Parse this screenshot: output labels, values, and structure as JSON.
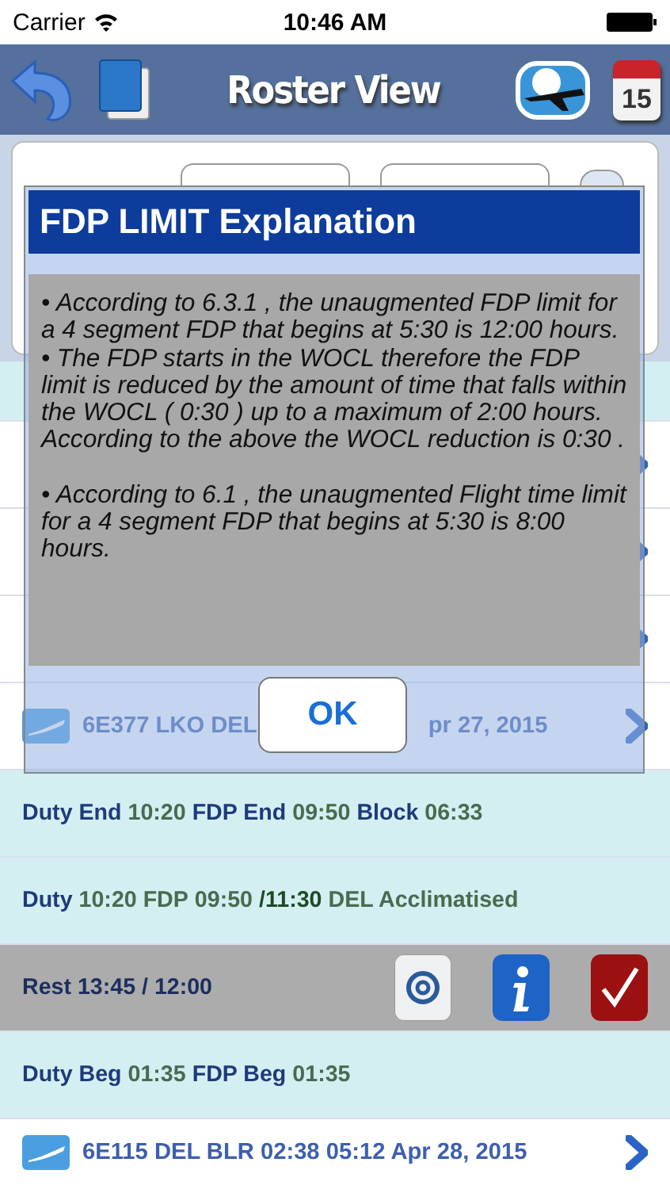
{
  "status_bar": {
    "carrier": "Carrier",
    "time": "10:46 AM"
  },
  "nav": {
    "title": "Roster View",
    "calendar_day": "15"
  },
  "rows": [
    {
      "kind": "band"
    },
    {
      "kind": "flight"
    },
    {
      "kind": "flight"
    },
    {
      "kind": "flight"
    },
    {
      "kind": "flight",
      "parts": [
        "6E377 LKO DEL",
        "pr 27, 2015"
      ]
    },
    {
      "kind": "duty",
      "segments": [
        {
          "kind": "label",
          "text": "Duty End"
        },
        {
          "kind": "value",
          "text": "10:20"
        },
        {
          "kind": "label",
          "text": "FDP End"
        },
        {
          "kind": "value",
          "text": "09:50"
        },
        {
          "kind": "label",
          "text": "Block"
        },
        {
          "kind": "value",
          "text": "06:33"
        }
      ]
    },
    {
      "kind": "duty",
      "segments": [
        {
          "kind": "label",
          "text": "Duty"
        },
        {
          "kind": "value",
          "text": "10:20 FDP"
        },
        {
          "kind": "value",
          "text": "09:50"
        },
        {
          "kind": "strong",
          "text": "/11:30"
        },
        {
          "kind": "value",
          "text": "DEL Acclimatised"
        }
      ]
    },
    {
      "kind": "rest",
      "text": "Rest 13:45 / 12:00"
    },
    {
      "kind": "duty",
      "segments": [
        {
          "kind": "label",
          "text": "Duty Beg"
        },
        {
          "kind": "value",
          "text": "01:35"
        },
        {
          "kind": "label",
          "text": "FDP Beg"
        },
        {
          "kind": "value",
          "text": "01:35"
        }
      ]
    },
    {
      "kind": "flight",
      "parts": [
        "6E115 DEL BLR 02:38 05:12 Apr 28, 2015"
      ]
    }
  ],
  "dialog": {
    "title": "FDP LIMIT Explanation",
    "paragraphs": [
      "•  According to 6.3.1 , the unaugmented FDP limit for a 4 segment FDP that begins at 5:30 is 12:00 hours.",
      "•  The FDP starts in the WOCL therefore the FDP limit is reduced by the amount of time that falls within the WOCL ( 0:30 ) up to a maximum of 2:00 hours. According to the above the WOCL reduction is 0:30 .",
      "•  According to 6.1 , the unaugmented Flight time limit for a 4 segment FDP that begins at 5:30 is 8:00 hours."
    ],
    "button": "OK"
  }
}
